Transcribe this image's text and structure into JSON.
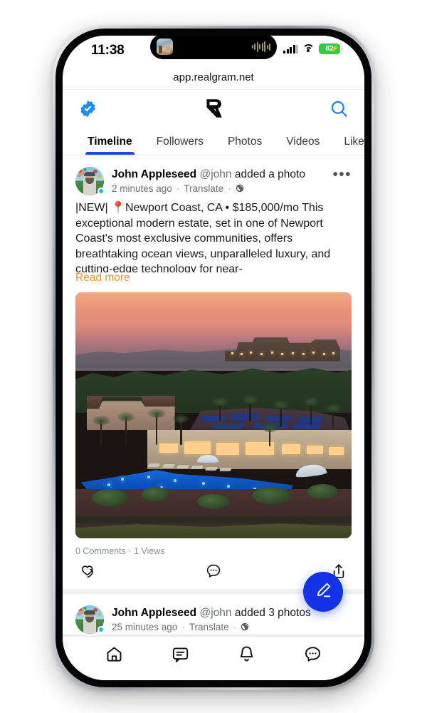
{
  "device": {
    "status_bar": {
      "time": "11:38",
      "battery_percent": "82",
      "battery_charging": true,
      "wifi_icon": "wifi-icon",
      "signal_icon": "cellular-signal-icon",
      "dynamic_island_icon": "now-playing-album-art",
      "dynamic_island_waveform": "audio-waveform-icon"
    }
  },
  "browser": {
    "url": "app.realgram.net"
  },
  "header": {
    "verified_badge_icon": "verified-badge-icon",
    "logo_icon": "realgram-logo-icon",
    "logo_letter": "R",
    "search_icon": "search-icon",
    "accent_color": "#1d8cf8"
  },
  "tabs": {
    "active_index": 0,
    "items": [
      {
        "label": "Timeline"
      },
      {
        "label": "Followers"
      },
      {
        "label": "Photos"
      },
      {
        "label": "Videos"
      },
      {
        "label": "Likes"
      }
    ],
    "indicator_color": "#2244ee"
  },
  "feed": {
    "posts": [
      {
        "author_name": "John Appleseed",
        "author_handle": "@john",
        "action": "added a photo",
        "timestamp": "2 minutes ago",
        "translate_label": "Translate",
        "visibility_icon": "globe-icon",
        "more_icon": "more-options-icon",
        "avatar_icon": "user-avatar",
        "online_status": "online",
        "body_tag": "|NEW|",
        "body_pin_icon": "location-pin-icon",
        "body_location": "Newport Coast, CA",
        "body_separator": "•",
        "body_price": "$185,000/mo",
        "body_text": "This exceptional modern estate, set in one of Newport Coast's most exclusive communities, offers breathtaking ocean views, unparalleled luxury, and cutting-edge technology for near-",
        "read_more_label": "Read more",
        "read_more_color": "#f0922b",
        "photo_alt": "luxury-estate-at-sunset-with-infinity-pool",
        "comments_count": "0 Comments",
        "stats_separator": "·",
        "views_count": "1 Views",
        "actions": [
          {
            "name": "like-icon",
            "label": "Like"
          },
          {
            "name": "comment-icon",
            "label": "Comment"
          },
          {
            "name": "share-icon",
            "label": "Share"
          }
        ]
      },
      {
        "author_name": "John Appleseed",
        "author_handle": "@john",
        "action": "added 3 photos",
        "timestamp": "25 minutes ago",
        "translate_label": "Translate",
        "visibility_icon": "globe-icon",
        "avatar_icon": "user-avatar",
        "online_status": "online"
      }
    ]
  },
  "fab": {
    "icon": "compose-pencil-icon",
    "color": "#1433e8"
  },
  "bottom_nav": {
    "items": [
      {
        "icon": "home-icon",
        "label": "Home"
      },
      {
        "icon": "messages-icon",
        "label": "Messages"
      },
      {
        "icon": "notifications-bell-icon",
        "label": "Notifications"
      },
      {
        "icon": "chat-bubble-icon",
        "label": "Chat"
      }
    ]
  }
}
